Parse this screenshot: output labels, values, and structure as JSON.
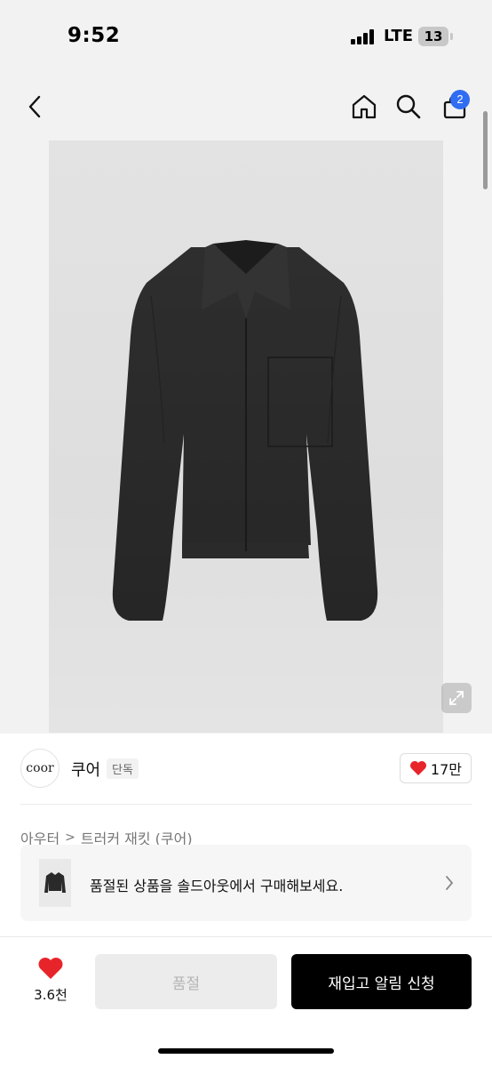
{
  "status_bar": {
    "time": "9:52",
    "network": "LTE",
    "battery": "13"
  },
  "nav": {
    "cart_count": "2",
    "icons": [
      "back-chevron-icon",
      "home-icon",
      "search-icon",
      "shopping-bag-icon"
    ]
  },
  "product": {
    "image_subject": "black-jacket",
    "expand_icon": "expand-arrows-icon"
  },
  "brand": {
    "logo_text": "coor",
    "name": "쿠어",
    "tag": "단독",
    "likes": "17만"
  },
  "breadcrumb": {
    "category": "아우터",
    "product_name": "트러커 재킷 (쿠어)"
  },
  "soldout_banner": {
    "text": "품절된 상품을 솔드아웃에서 구매해보세요."
  },
  "bottom_bar": {
    "wish_count": "3.6천",
    "soldout_label": "품절",
    "restock_label": "재입고 알림 신청"
  },
  "colors": {
    "heart": "#e8242b",
    "badge": "#2f6df3",
    "primary_button": "#000000"
  }
}
